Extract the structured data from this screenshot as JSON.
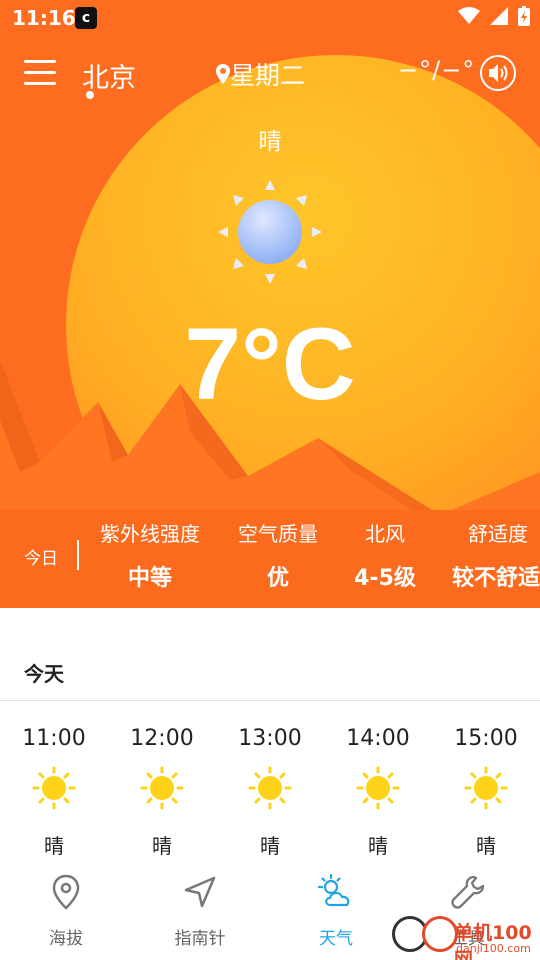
{
  "status_bar": {
    "time": "11:16",
    "app_icon": "notification-app-icon",
    "icons": [
      "wifi-icon",
      "signal-icon",
      "battery-charging-icon"
    ]
  },
  "header": {
    "city": "北京",
    "weekday": "星期二",
    "temp_range": "−°/−°",
    "menu_icon": "menu-icon",
    "location_icon": "location-pin-icon",
    "sound_icon": "speaker-icon"
  },
  "current": {
    "condition": "晴",
    "temperature": "7°C",
    "icon": "sunny-icon"
  },
  "stats": {
    "today_label": "今日",
    "items": [
      {
        "label": "紫外线强度",
        "value": "中等"
      },
      {
        "label": "空气质量",
        "value": "优"
      },
      {
        "label": "北风",
        "value": "4-5级"
      },
      {
        "label": "舒适度",
        "value": "较不舒适"
      }
    ]
  },
  "forecast": {
    "title": "今天",
    "hours": [
      {
        "time": "11:00",
        "condition": "晴",
        "icon": "sun-icon"
      },
      {
        "time": "12:00",
        "condition": "晴",
        "icon": "sun-icon"
      },
      {
        "time": "13:00",
        "condition": "晴",
        "icon": "sun-icon"
      },
      {
        "time": "14:00",
        "condition": "晴",
        "icon": "sun-icon"
      },
      {
        "time": "15:00",
        "condition": "晴",
        "icon": "sun-icon"
      }
    ]
  },
  "nav": {
    "items": [
      {
        "label": "海拔",
        "icon": "location-pin-icon",
        "active": false
      },
      {
        "label": "指南针",
        "icon": "navigation-arrow-icon",
        "active": false
      },
      {
        "label": "天气",
        "icon": "cloud-sun-icon",
        "active": true
      },
      {
        "label": "工具",
        "icon": "wrench-icon",
        "active": false
      }
    ]
  },
  "watermark": {
    "text": "单机100网",
    "url": "danji100.com"
  },
  "colors": {
    "primary_orange": "#fd6c1f",
    "sun_yellow": "#ffc52a",
    "active_blue": "#1fa5e6"
  }
}
